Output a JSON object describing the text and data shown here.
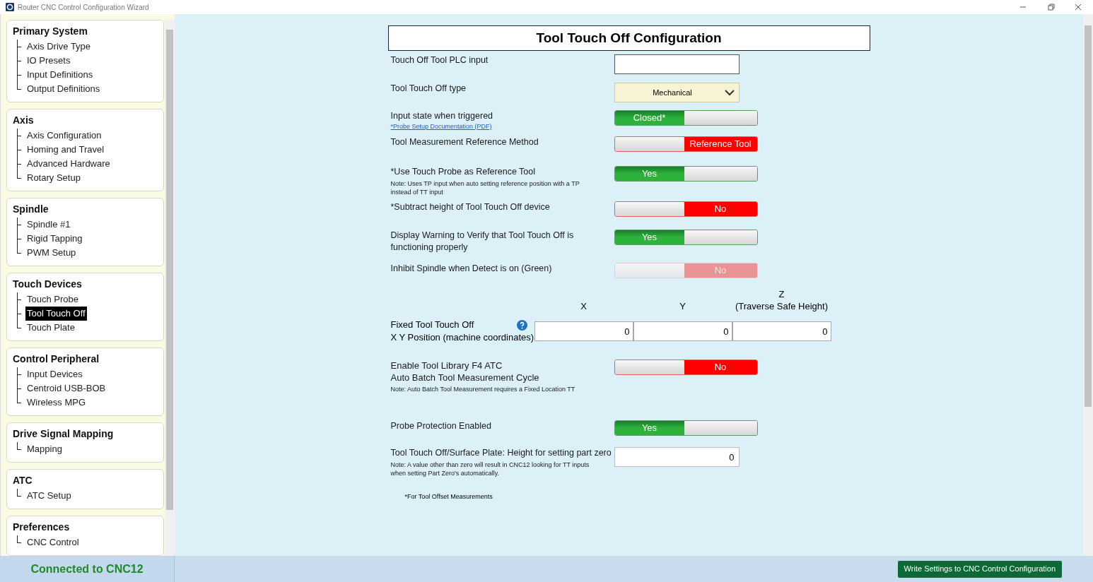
{
  "window": {
    "title": "Router CNC Control Configuration Wizard"
  },
  "sidebar": {
    "groups": [
      {
        "title": "Primary System",
        "items": [
          {
            "label": "Axis Drive Type",
            "selected": false
          },
          {
            "label": "IO Presets",
            "selected": false
          },
          {
            "label": "Input Definitions",
            "selected": false
          },
          {
            "label": "Output Definitions",
            "selected": false
          }
        ]
      },
      {
        "title": "Axis",
        "items": [
          {
            "label": "Axis Configuration",
            "selected": false
          },
          {
            "label": "Homing and Travel",
            "selected": false
          },
          {
            "label": "Advanced Hardware",
            "selected": false
          },
          {
            "label": "Rotary Setup",
            "selected": false
          }
        ]
      },
      {
        "title": "Spindle",
        "items": [
          {
            "label": "Spindle #1",
            "selected": false
          },
          {
            "label": "Rigid Tapping",
            "selected": false
          },
          {
            "label": "PWM Setup",
            "selected": false
          }
        ]
      },
      {
        "title": "Touch Devices",
        "items": [
          {
            "label": "Touch Probe",
            "selected": false
          },
          {
            "label": "Tool Touch Off",
            "selected": true
          },
          {
            "label": "Touch Plate",
            "selected": false
          }
        ]
      },
      {
        "title": "Control Peripheral",
        "items": [
          {
            "label": "Input Devices",
            "selected": false
          },
          {
            "label": "Centroid USB-BOB",
            "selected": false
          },
          {
            "label": "Wireless MPG",
            "selected": false
          }
        ]
      },
      {
        "title": "Drive Signal Mapping",
        "items": [
          {
            "label": "Mapping",
            "selected": false
          }
        ]
      },
      {
        "title": "ATC",
        "items": [
          {
            "label": "ATC Setup",
            "selected": false
          }
        ]
      },
      {
        "title": "Preferences",
        "items": [
          {
            "label": "CNC Control",
            "selected": false
          }
        ]
      }
    ]
  },
  "form": {
    "title": "Tool Touch Off Configuration",
    "rows": [
      {
        "kind": "text",
        "label": "Touch Off Tool PLC input"
      },
      {
        "kind": "dropdown",
        "label": "Tool Touch Off type",
        "value": "Mechanical"
      },
      {
        "kind": "toggle",
        "label": "Input state when triggered",
        "link": "*Probe Setup Documentation (PDF)",
        "switch": {
          "text": "Closed*",
          "on": true,
          "disabled": false
        }
      },
      {
        "kind": "toggle",
        "label": "Tool Measurement Reference Method",
        "switch": {
          "text": "Reference Tool",
          "on": false,
          "disabled": false
        }
      },
      {
        "kind": "toggle",
        "label": "*Use Touch Probe as Reference Tool",
        "note": "Note: Uses TP input when auto setting reference position with a TP instead of TT input",
        "switch": {
          "text": "Yes",
          "on": true,
          "disabled": false
        }
      },
      {
        "kind": "toggle",
        "label": "*Subtract height of Tool Touch Off device",
        "switch": {
          "text": "No",
          "on": false,
          "disabled": false
        }
      },
      {
        "kind": "toggle",
        "label": "Display Warning to Verify that Tool Touch Off is functioning properly",
        "switch": {
          "text": "Yes",
          "on": true,
          "disabled": false
        }
      },
      {
        "kind": "toggle",
        "label": "Inhibit Spindle when Detect is on (Green)",
        "switch": {
          "text": "No",
          "on": false,
          "disabled": true
        }
      },
      {
        "kind": "xyz",
        "label_lines": [
          "Fixed Tool Touch Off",
          "X Y Position (machine coordinates)"
        ],
        "columns": [
          {
            "label": "X",
            "value": "0"
          },
          {
            "label": "Y",
            "value": "0"
          },
          {
            "label": "Z",
            "sublabel": "(Traverse Safe Height)",
            "value": "0"
          }
        ]
      },
      {
        "kind": "toggle",
        "label_lines": [
          "Enable Tool Library F4 ATC",
          "Auto Batch Tool Measurement Cycle"
        ],
        "note": "Note: Auto Batch Tool Measurement requires a Fixed Location TT",
        "switch": {
          "text": "No",
          "on": false,
          "disabled": false
        }
      },
      {
        "kind": "toggle",
        "label": "Probe Protection Enabled",
        "switch": {
          "text": "Yes",
          "on": true,
          "disabled": false
        }
      },
      {
        "kind": "number",
        "label": "Tool Touch Off/Surface Plate:  Height for setting part zero",
        "note": "Note: A value other than zero will result in CNC12 looking for TT inputs when setting Part Zero's automatically.",
        "value": "0"
      }
    ],
    "footnote": "*For Tool Offset Measurements"
  },
  "status_bar": {
    "connection": "Connected to CNC12",
    "write_button": "Write Settings to CNC Control Configuration"
  }
}
